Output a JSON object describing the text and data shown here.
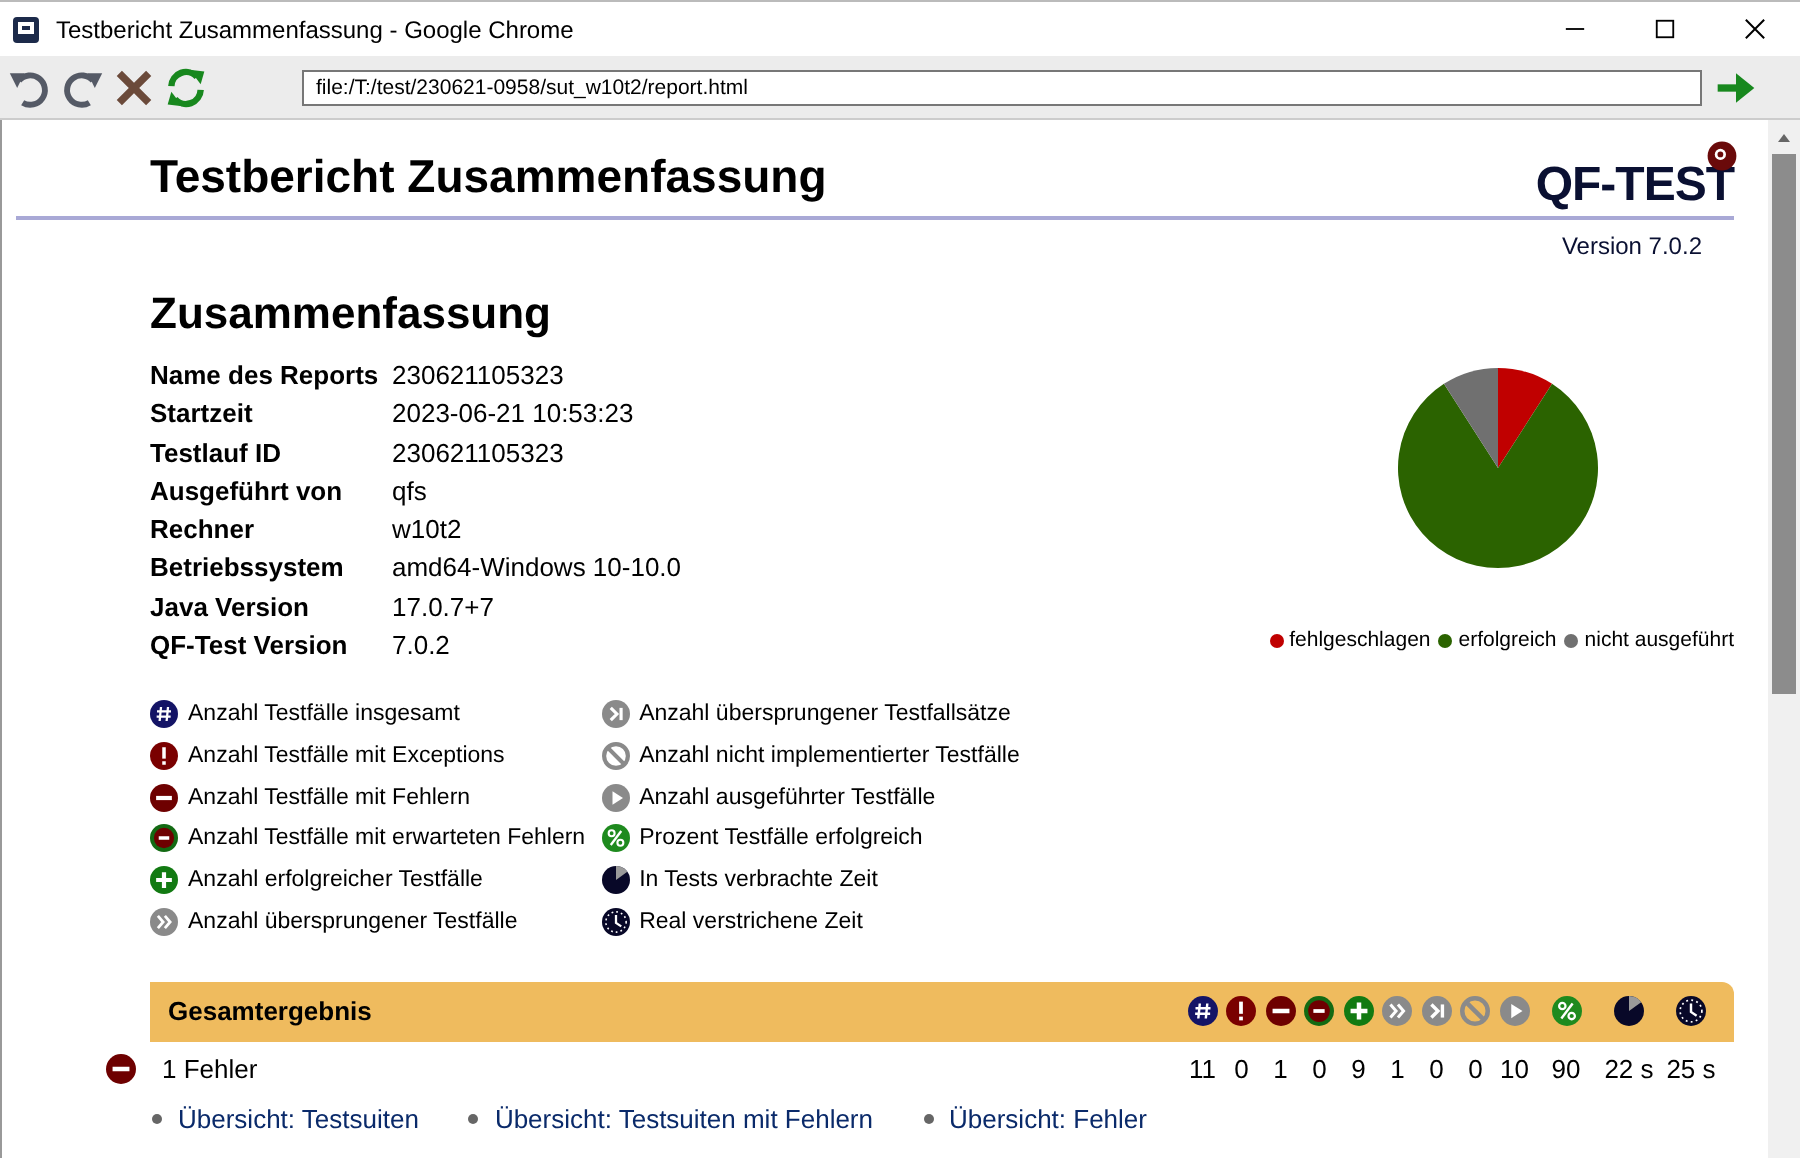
{
  "window": {
    "title": "Testbericht Zusammenfassung - Google Chrome"
  },
  "address_bar": {
    "value": "file:/T:/test/230621-0958/sut_w10t2/report.html"
  },
  "report": {
    "title": "Testbericht Zusammenfassung",
    "logo": "QF-TEST",
    "version": "Version 7.0.2"
  },
  "summary": {
    "heading": "Zusammenfassung",
    "rows": [
      {
        "label": "Name des Reports",
        "value": "230621105323"
      },
      {
        "label": "Startzeit",
        "value": "2023-06-21 10:53:23"
      },
      {
        "label": "Testlauf ID",
        "value": "230621105323"
      },
      {
        "label": "Ausgeführt von",
        "value": "qfs"
      },
      {
        "label": "Rechner",
        "value": "w10t2"
      },
      {
        "label": "Betriebssystem",
        "value": "amd64-Windows 10-10.0"
      },
      {
        "label": "Java Version",
        "value": "17.0.7+7"
      },
      {
        "label": "QF-Test Version",
        "value": "7.0.2"
      }
    ]
  },
  "chart_data": {
    "type": "pie",
    "categories": [
      "fehlgeschlagen",
      "erfolgreich",
      "nicht ausgeführt"
    ],
    "values": [
      9.09,
      81.82,
      9.09
    ],
    "colors": [
      "#c00000",
      "#2b6300",
      "#707070"
    ]
  },
  "legend": {
    "columns": [
      [
        {
          "kind": "total",
          "label": "Anzahl Testfälle insgesamt"
        },
        {
          "kind": "exception",
          "label": "Anzahl Testfälle mit Exceptions"
        },
        {
          "kind": "error",
          "label": "Anzahl Testfälle mit Fehlern"
        },
        {
          "kind": "expected",
          "label": "Anzahl Testfälle mit erwarteten Fehlern"
        },
        {
          "kind": "success",
          "label": "Anzahl erfolgreicher Testfälle"
        },
        {
          "kind": "skipped",
          "label": "Anzahl übersprungener Testfälle"
        }
      ],
      [
        {
          "kind": "skipset",
          "label": "Anzahl übersprungener Testfallsätze"
        },
        {
          "kind": "notimpl",
          "label": "Anzahl nicht implementierter Testfälle"
        },
        {
          "kind": "run",
          "label": "Anzahl ausgeführter Testfälle"
        },
        {
          "kind": "percent",
          "label": "Prozent Testfälle erfolgreich"
        },
        {
          "kind": "time",
          "label": "In Tests verbrachte Zeit"
        },
        {
          "kind": "realtime",
          "label": "Real verstrichene Zeit"
        }
      ]
    ]
  },
  "result": {
    "title": "Gesamtergebnis",
    "status": {
      "kind": "error",
      "text": "1 Fehler"
    },
    "stats": [
      {
        "kind": "total",
        "value": "11"
      },
      {
        "kind": "exception",
        "value": "0"
      },
      {
        "kind": "error",
        "value": "1"
      },
      {
        "kind": "expected",
        "value": "0"
      },
      {
        "kind": "success",
        "value": "9"
      },
      {
        "kind": "skipped",
        "value": "1"
      },
      {
        "kind": "skipset",
        "value": "0"
      },
      {
        "kind": "notimpl",
        "value": "0"
      },
      {
        "kind": "run",
        "value": "10"
      },
      {
        "kind": "percent",
        "value": "90"
      },
      {
        "kind": "time",
        "value": "22 s"
      },
      {
        "kind": "realtime",
        "value": "25 s"
      }
    ]
  },
  "links": [
    "Übersicht: Testsuiten",
    "Übersicht: Testsuiten mit Fehlern",
    "Übersicht: Fehler"
  ]
}
